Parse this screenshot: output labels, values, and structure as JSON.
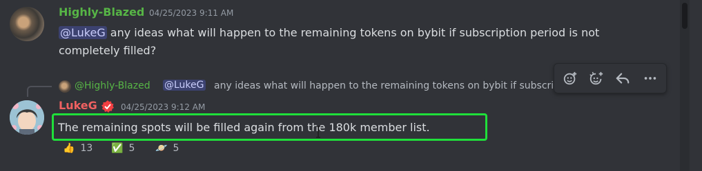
{
  "message1": {
    "username": "Highly-Blazed",
    "timestamp": "04/25/2023 9:11 AM",
    "mention": "@LukeG",
    "text": " any ideas what will happen to the remaining tokens on bybit if subscription period is not completely filled?"
  },
  "reply_preview": {
    "username": "@Highly-Blazed",
    "mention": "@LukeG",
    "text": "any ideas what will happen to the remaining tokens on bybit if subscription period is not completely filled?"
  },
  "message2": {
    "username": "LukeG",
    "timestamp": "04/25/2023 9:12 AM",
    "text": "The remaining spots will be filled again from the 180k member list."
  },
  "reactions": [
    {
      "emoji": "👍",
      "count": "13"
    },
    {
      "emoji": "✅",
      "count": "5"
    },
    {
      "emoji": "🪐",
      "count": "5"
    }
  ],
  "toolbar": {
    "icons": [
      "add-reaction-icon",
      "add-super-reaction-icon",
      "reply-icon",
      "more-options-icon"
    ]
  },
  "colors": {
    "background": "#313338",
    "username1": "#57b546",
    "username2": "#f06161",
    "mention_bg": "#3c4270",
    "highlight": "#1fe03a"
  }
}
